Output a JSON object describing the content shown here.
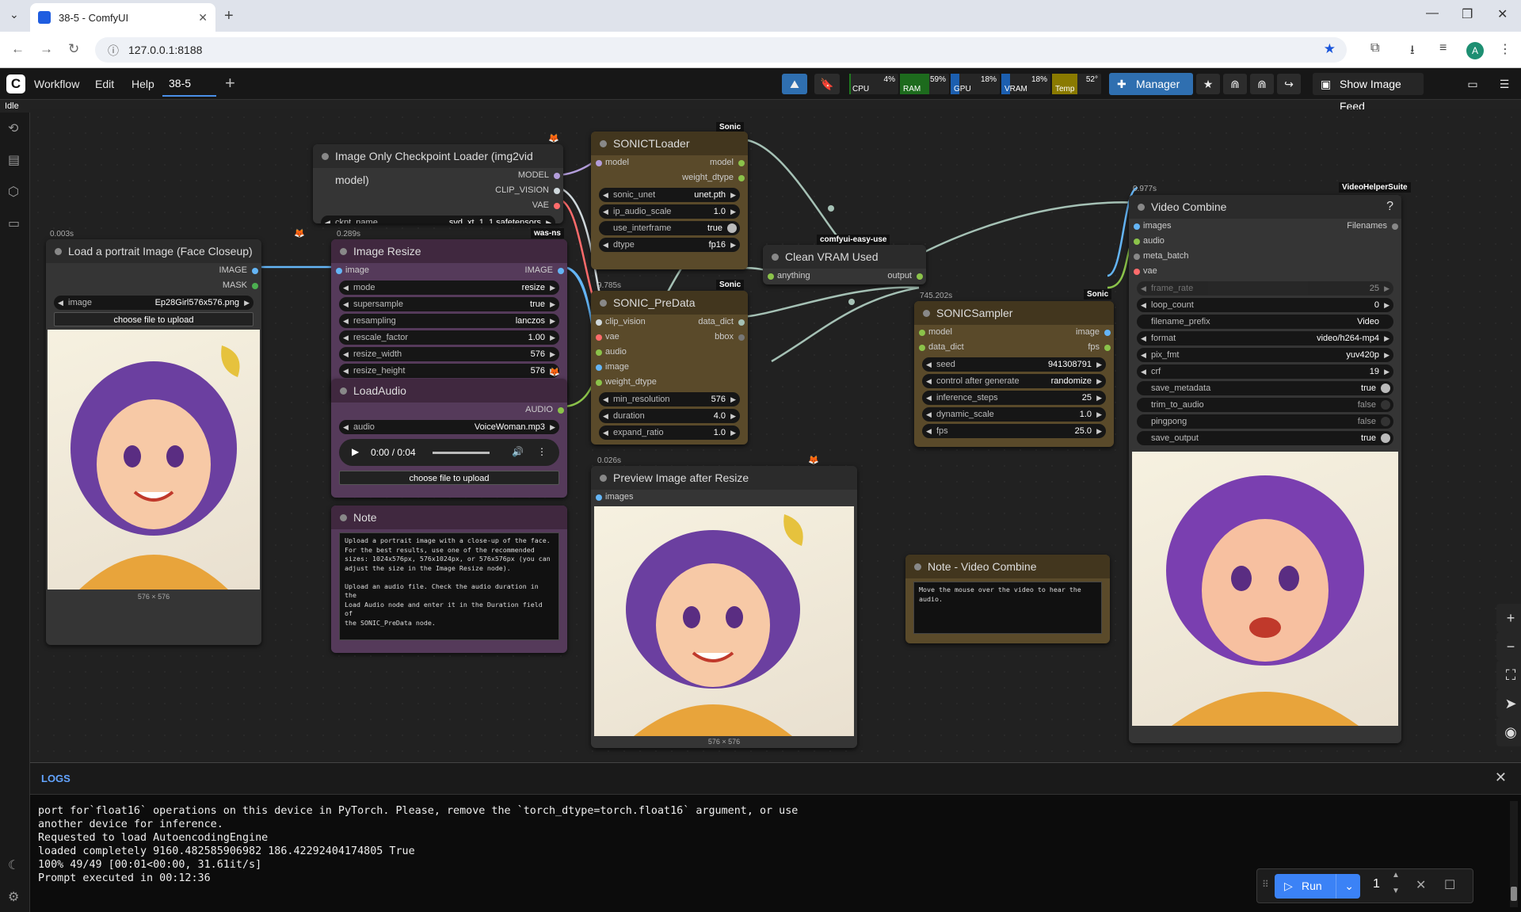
{
  "browser": {
    "tab_title": "38-5 - ComfyUI",
    "url": "127.0.0.1:8188",
    "avatar_letter": "A"
  },
  "menubar": {
    "logo": "C",
    "menus": [
      "Workflow",
      "Edit",
      "Help"
    ],
    "workflow_tab": "38-5",
    "monitors": [
      {
        "label": "CPU",
        "pct": "4%",
        "value": 4,
        "color": "#1f7a1f"
      },
      {
        "label": "RAM",
        "pct": "59%",
        "value": 59,
        "color": "#1d6b1d"
      },
      {
        "label": "GPU",
        "pct": "18%",
        "value": 18,
        "color": "#1c5fb0"
      },
      {
        "label": "VRAM",
        "pct": "18%",
        "value": 18,
        "color": "#1c5fb0"
      },
      {
        "label": "Temp",
        "pct": "52°",
        "value": 52,
        "color": "#8a7a00"
      }
    ],
    "manager": "Manager",
    "show_feed": "Show Image Feed"
  },
  "status": "Idle",
  "nodes": {
    "checkpoint": {
      "title": "Image Only Checkpoint Loader (img2vid model)",
      "outputs": [
        "MODEL",
        "CLIP_VISION",
        "VAE"
      ],
      "ckpt_label": "ckpt_name",
      "ckpt_value": "svd_xt_1_1.safetensors"
    },
    "load_image": {
      "title": "Load a portrait Image (Face Closeup)",
      "time": "0.003s",
      "outputs": [
        "IMAGE",
        "MASK"
      ],
      "image_label": "image",
      "image_value": "Ep28Girl576x576.png",
      "upload": "choose file to upload",
      "dims": "576 × 576"
    },
    "resize": {
      "title": "Image Resize",
      "time": "0.289s",
      "badge": "was-ns",
      "input": "image",
      "output": "IMAGE",
      "widgets": [
        [
          "mode",
          "resize"
        ],
        [
          "supersample",
          "true"
        ],
        [
          "resampling",
          "lanczos"
        ],
        [
          "rescale_factor",
          "1.00"
        ],
        [
          "resize_width",
          "576"
        ],
        [
          "resize_height",
          "576"
        ]
      ]
    },
    "sonic_loader": {
      "title": "SONICTLoader",
      "badge": "Sonic",
      "input": "model",
      "outputs": [
        "model",
        "weight_dtype"
      ],
      "widgets": [
        [
          "sonic_unet",
          "unet.pth"
        ],
        [
          "ip_audio_scale",
          "1.0"
        ],
        [
          "use_interframe",
          "true"
        ],
        [
          "dtype",
          "fp16"
        ]
      ]
    },
    "predata": {
      "title": "SONIC_PreData",
      "time": "9.785s",
      "badge": "Sonic",
      "inputs": [
        "clip_vision",
        "vae",
        "audio",
        "image",
        "weight_dtype"
      ],
      "outputs": [
        "data_dict",
        "bbox"
      ],
      "widgets": [
        [
          "min_resolution",
          "576"
        ],
        [
          "duration",
          "4.0"
        ],
        [
          "expand_ratio",
          "1.0"
        ]
      ]
    },
    "clean_vram": {
      "title": "Clean VRAM Used",
      "badge": "comfyui-easy-use",
      "input": "anything",
      "output": "output"
    },
    "sampler": {
      "title": "SONICSampler",
      "time": "745.202s",
      "badge": "Sonic",
      "inputs": [
        "model",
        "data_dict"
      ],
      "outputs": [
        "image",
        "fps"
      ],
      "widgets": [
        [
          "seed",
          "941308791"
        ],
        [
          "control after generate",
          "randomize"
        ],
        [
          "inference_steps",
          "25"
        ],
        [
          "dynamic_scale",
          "1.0"
        ],
        [
          "fps",
          "25.0"
        ]
      ]
    },
    "load_audio": {
      "title": "LoadAudio",
      "output": "AUDIO",
      "audio_label": "audio",
      "audio_value": "VoiceWoman.mp3",
      "player_time": "0:00 / 0:04",
      "upload": "choose file to upload"
    },
    "preview": {
      "title": "Preview Image after Resize",
      "time": "0.026s",
      "input": "images",
      "dims": "576 × 576"
    },
    "note": {
      "title": "Note",
      "text": "Upload a portrait image with a close-up of the face.\nFor the best results, use one of the recommended\nsizes: 1024x576px, 576x1024px, or 576x576px (you can\nadjust the size in the Image Resize node).\n\nUpload an audio file. Check the audio duration in the\nLoad Audio node and enter it in the Duration field of\nthe SONIC_PreData node."
    },
    "note_video": {
      "title": "Note - Video Combine",
      "text": "Move the mouse over the video to hear the\naudio."
    },
    "video_combine": {
      "title": "Video Combine",
      "time": "0.977s",
      "badge": "VideoHelperSuite",
      "inputs": [
        "images",
        "audio",
        "meta_batch",
        "vae"
      ],
      "output": "Filenames",
      "help": "?",
      "widgets": [
        [
          "frame_rate",
          "25"
        ],
        [
          "loop_count",
          "0"
        ],
        [
          "filename_prefix",
          "Video"
        ],
        [
          "format",
          "video/h264-mp4"
        ],
        [
          "pix_fmt",
          "yuv420p"
        ],
        [
          "crf",
          "19"
        ],
        [
          "save_metadata",
          "true"
        ],
        [
          "trim_to_audio",
          "false"
        ],
        [
          "pingpong",
          "false"
        ],
        [
          "save_output",
          "true"
        ]
      ]
    }
  },
  "logs": {
    "title": "LOGS",
    "lines": [
      "port for`float16` operations on this device in PyTorch. Please, remove the `torch_dtype=torch.float16` argument, or use",
      "another device for inference.",
      "Requested to load AutoencodingEngine",
      "loaded completely 9160.482585906982 186.42292404174805 True",
      "100% 49/49 [00:01<00:00, 31.61it/s]",
      "Prompt executed in 00:12:36"
    ]
  },
  "run": {
    "label": "Run",
    "count": "1"
  },
  "colors": {
    "image_pin": "#64b5f6",
    "audio_pin": "#8bc34a",
    "vae_pin": "#ff6b6b",
    "model_pin": "#b39ddb",
    "clip_pin": "#cccccc"
  }
}
